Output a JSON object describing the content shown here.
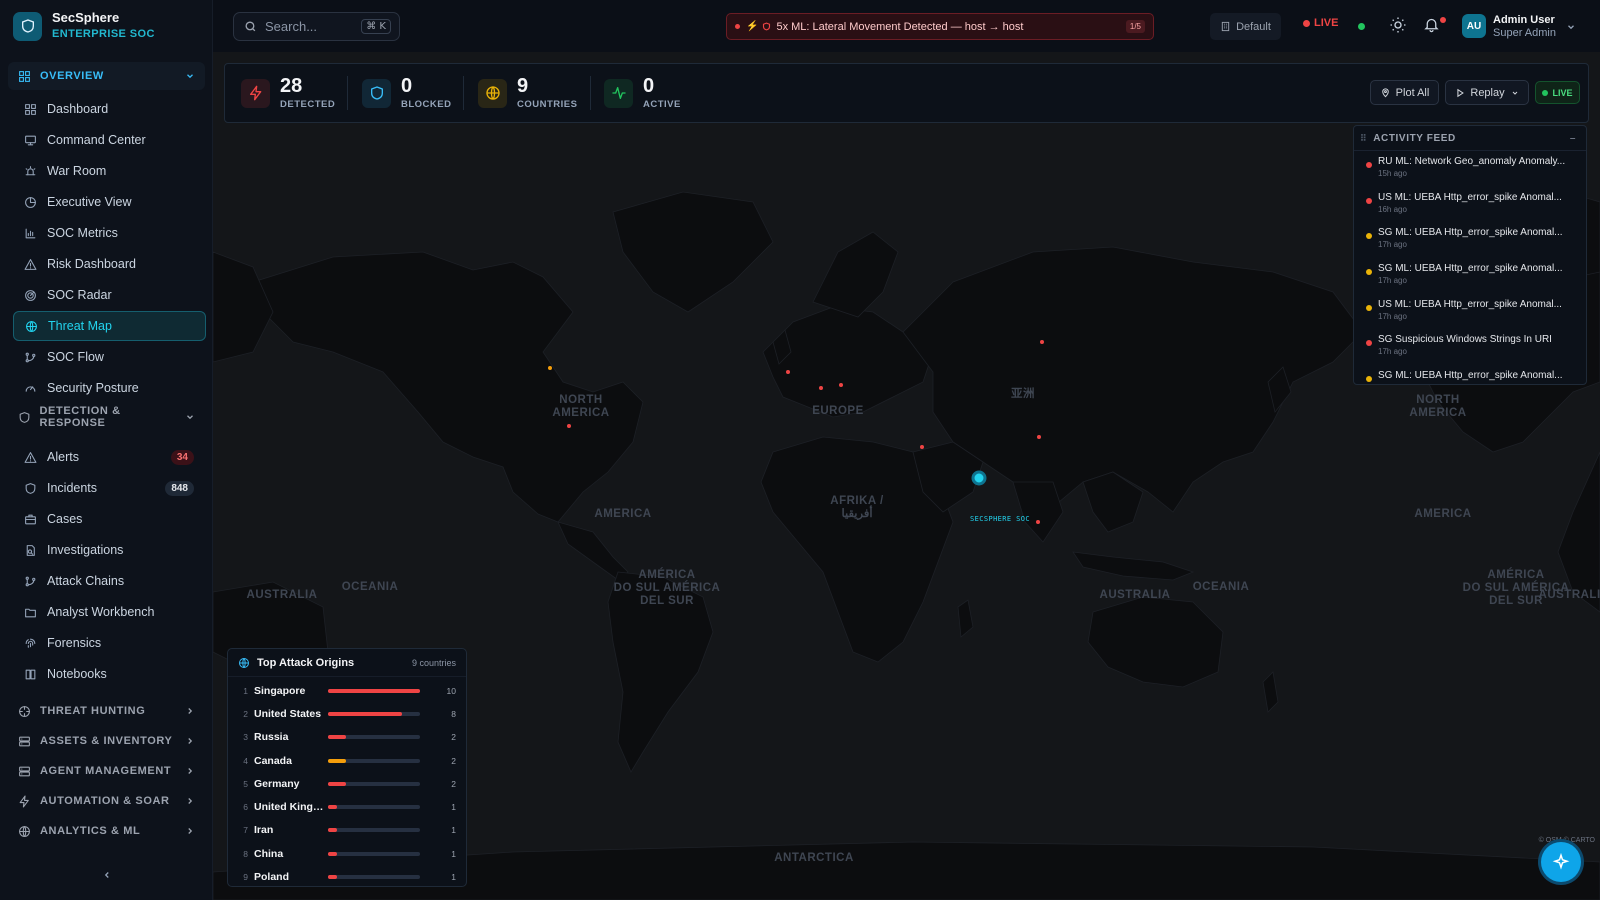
{
  "brand": {
    "name": "SecSphere",
    "subtitle": "ENTERPRISE SOC"
  },
  "sidebar": {
    "overview": {
      "label": "OVERVIEW",
      "items": [
        {
          "label": "Dashboard",
          "icon": "dashboard-icon"
        },
        {
          "label": "Command Center",
          "icon": "monitor-icon"
        },
        {
          "label": "War Room",
          "icon": "siren-icon"
        },
        {
          "label": "Executive View",
          "icon": "pie-chart-icon"
        },
        {
          "label": "SOC Metrics",
          "icon": "bar-chart-icon"
        },
        {
          "label": "Risk Dashboard",
          "icon": "warning-icon"
        },
        {
          "label": "SOC Radar",
          "icon": "radar-icon"
        },
        {
          "label": "Threat Map",
          "icon": "globe-icon",
          "active": true
        },
        {
          "label": "SOC Flow",
          "icon": "flow-icon"
        },
        {
          "label": "Security Posture",
          "icon": "gauge-icon"
        }
      ]
    },
    "detection": {
      "label": "DETECTION & RESPONSE",
      "items": [
        {
          "label": "Alerts",
          "icon": "warning-icon",
          "badge": "34"
        },
        {
          "label": "Incidents",
          "icon": "shield-icon",
          "badge": "848"
        },
        {
          "label": "Cases",
          "icon": "briefcase-icon"
        },
        {
          "label": "Investigations",
          "icon": "document-search-icon"
        },
        {
          "label": "Attack Chains",
          "icon": "chain-icon"
        },
        {
          "label": "Analyst Workbench",
          "icon": "folder-icon"
        },
        {
          "label": "Forensics",
          "icon": "fingerprint-icon"
        },
        {
          "label": "Notebooks",
          "icon": "book-icon"
        }
      ]
    },
    "sections": [
      {
        "label": "THREAT HUNTING",
        "icon": "crosshair-icon"
      },
      {
        "label": "ASSETS & INVENTORY",
        "icon": "server-icon"
      },
      {
        "label": "AGENT MANAGEMENT",
        "icon": "server-icon"
      },
      {
        "label": "AUTOMATION & SOAR",
        "icon": "bolt-icon"
      },
      {
        "label": "ANALYTICS & ML",
        "icon": "globe-icon"
      }
    ]
  },
  "topbar": {
    "search_placeholder": "Search...",
    "search_shortcut": "⌘ K",
    "alert_text": "5x ML: Lateral Movement Detected — host → host",
    "alert_counter": "1/5",
    "workspace": "Default",
    "live": "LIVE",
    "user_initials": "AU",
    "user_name": "Admin User",
    "user_role": "Super Admin"
  },
  "stats": [
    {
      "value": "28",
      "label": "DETECTED",
      "color": "#ef4444",
      "icon": "bolt-icon"
    },
    {
      "value": "0",
      "label": "BLOCKED",
      "color": "#38bdf8",
      "icon": "shield-icon"
    },
    {
      "value": "9",
      "label": "COUNTRIES",
      "color": "#eab308",
      "icon": "globe-icon"
    },
    {
      "value": "0",
      "label": "ACTIVE",
      "color": "#22c55e",
      "icon": "activity-icon"
    }
  ],
  "map_controls": {
    "plot_all": "Plot All",
    "replay": "Replay",
    "live": "LIVE"
  },
  "map": {
    "labels": [
      {
        "text": "NORTH\nAMERICA"
      },
      {
        "text": "EUROPE"
      },
      {
        "text": "亚洲"
      },
      {
        "text": "AFRIKA /\nأفريقيا"
      },
      {
        "text": "AMERICA"
      },
      {
        "text": "AMÉRICA\nDO SUL AMÉRICA\nDEL SUR"
      },
      {
        "text": "AUSTRALIA"
      },
      {
        "text": "OCEANIA"
      },
      {
        "text": "NORTH\nAMERICA"
      },
      {
        "text": "AMERICA"
      },
      {
        "text": "AMÉRICA\nDO SUL AMÉRICA\nDEL SUR"
      },
      {
        "text": "AUSTRALIA"
      },
      {
        "text": "OCEANIA"
      },
      {
        "text": "ANTARCTICA"
      },
      {
        "text": "AUSTRALIA"
      }
    ],
    "soc_label": "SECSPHERE SOC",
    "credit": "© OSM © CARTO"
  },
  "activity_feed": {
    "title": "ACTIVITY FEED",
    "items": [
      {
        "text": "RU ML: Network Geo_anomaly Anomaly...",
        "ago": "15h ago",
        "color": "#ef4444"
      },
      {
        "text": "US ML: UEBA Http_error_spike Anomal...",
        "ago": "16h ago",
        "color": "#ef4444"
      },
      {
        "text": "SG ML: UEBA Http_error_spike Anomal...",
        "ago": "17h ago",
        "color": "#eab308"
      },
      {
        "text": "SG ML: UEBA Http_error_spike Anomal...",
        "ago": "17h ago",
        "color": "#eab308"
      },
      {
        "text": "US ML: UEBA Http_error_spike Anomal...",
        "ago": "17h ago",
        "color": "#eab308"
      },
      {
        "text": "SG Suspicious Windows Strings In URI",
        "ago": "17h ago",
        "color": "#ef4444"
      },
      {
        "text": "SG ML: UEBA Http_error_spike Anomal...",
        "ago": "",
        "color": "#eab308"
      }
    ]
  },
  "top_origins": {
    "title": "Top Attack Origins",
    "count_label": "9 countries",
    "rows": [
      {
        "rank": "1",
        "country": "Singapore",
        "value": 10,
        "color": "#ef4444"
      },
      {
        "rank": "2",
        "country": "United States",
        "value": 8,
        "color": "#ef4444"
      },
      {
        "rank": "3",
        "country": "Russia",
        "value": 2,
        "color": "#ef4444"
      },
      {
        "rank": "4",
        "country": "Canada",
        "value": 2,
        "color": "#f59e0b"
      },
      {
        "rank": "5",
        "country": "Germany",
        "value": 2,
        "color": "#ef4444"
      },
      {
        "rank": "6",
        "country": "United Kingdom",
        "value": 1,
        "color": "#ef4444"
      },
      {
        "rank": "7",
        "country": "Iran",
        "value": 1,
        "color": "#ef4444"
      },
      {
        "rank": "8",
        "country": "China",
        "value": 1,
        "color": "#ef4444"
      },
      {
        "rank": "9",
        "country": "Poland",
        "value": 1,
        "color": "#ef4444"
      }
    ]
  }
}
